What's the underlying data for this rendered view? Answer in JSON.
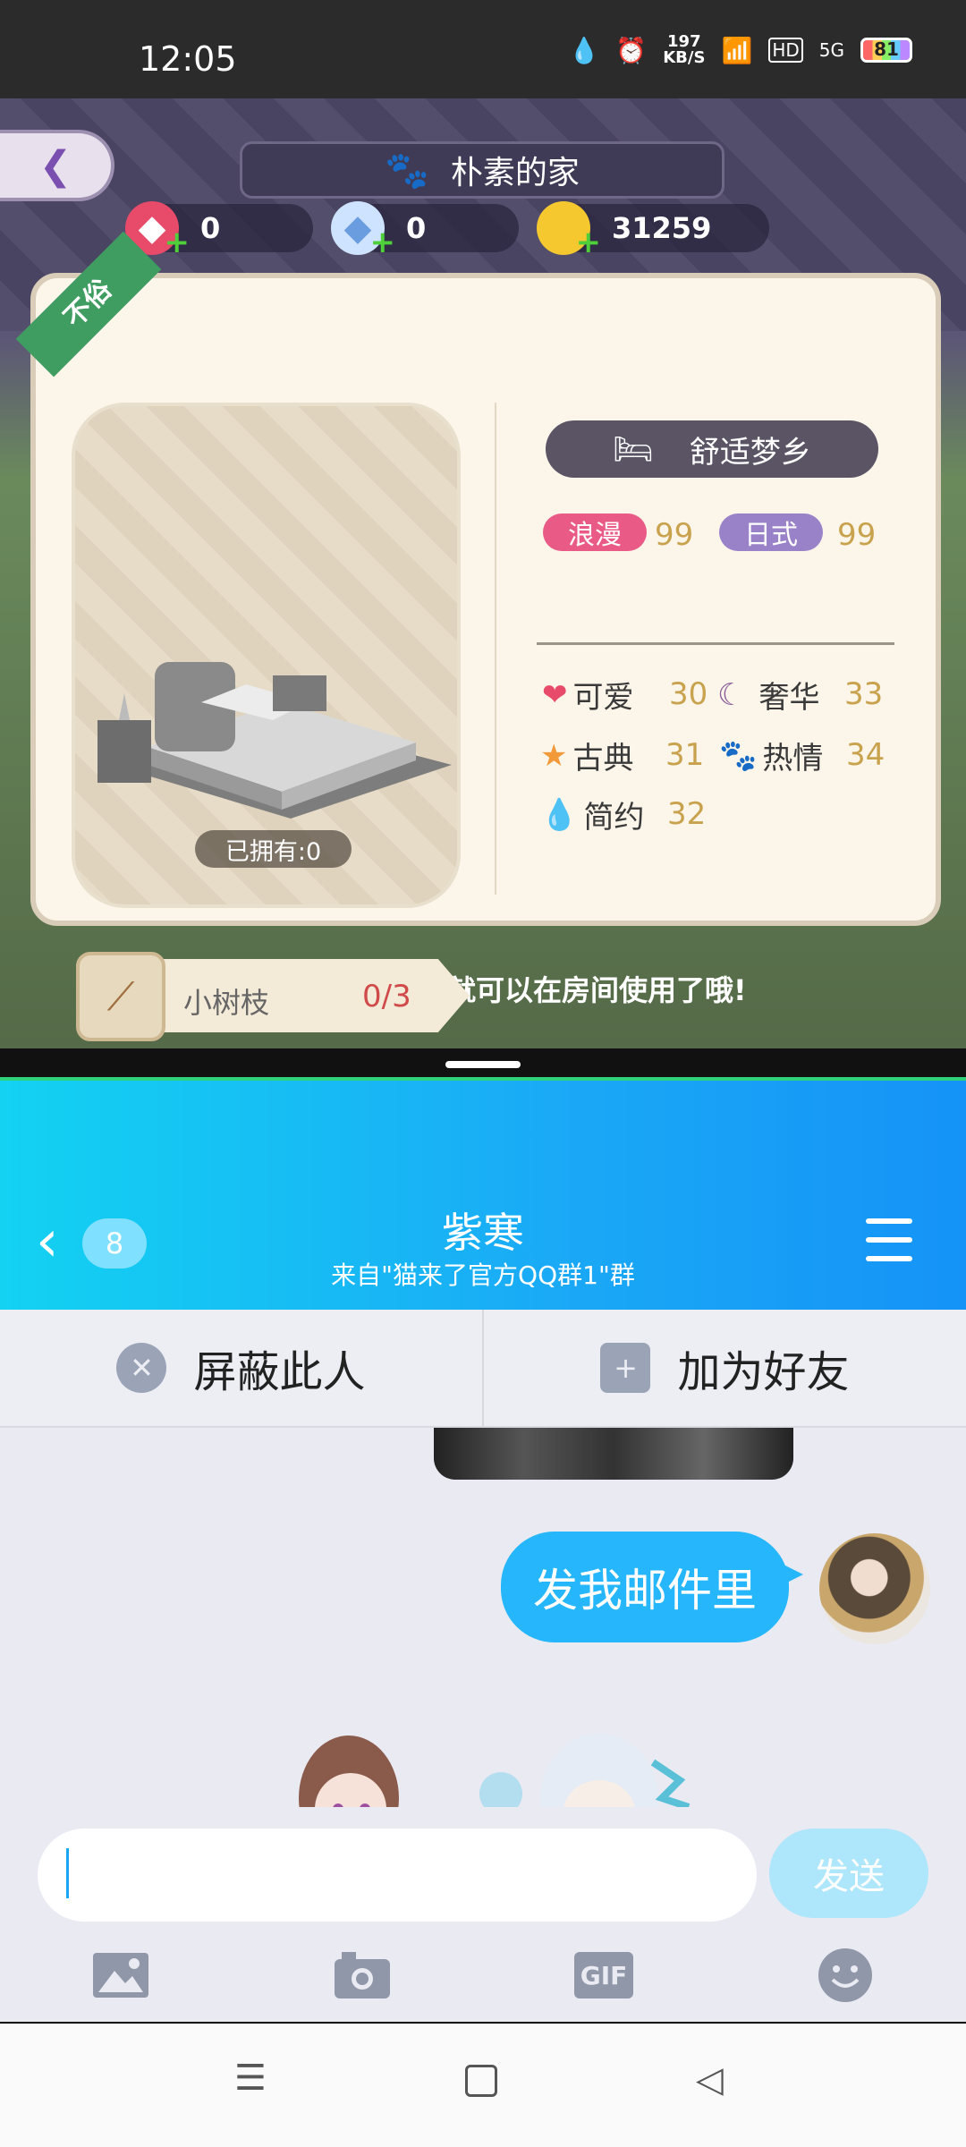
{
  "status_bar": {
    "time": "12:05",
    "speed_value": "197",
    "speed_unit": "KB/S",
    "hd": "HD",
    "network": "5G",
    "battery": "81"
  },
  "game": {
    "room_title": "朴素的家",
    "currency": {
      "ruby": "0",
      "diamond": "0",
      "gold": "31259"
    },
    "ribbon": "不俗",
    "owned_label": "已拥有:0",
    "set_name": "舒适梦乡",
    "tags": [
      {
        "label": "浪漫",
        "value": "99",
        "color": "#ea5a86"
      },
      {
        "label": "日式",
        "value": "99",
        "color": "#9a82c8"
      }
    ],
    "attributes": [
      {
        "label": "可爱",
        "value": "30",
        "icon": "heart-swirl-icon"
      },
      {
        "label": "奢华",
        "value": "33",
        "icon": "moon-icon"
      },
      {
        "label": "古典",
        "value": "31",
        "icon": "star-icon"
      },
      {
        "label": "热情",
        "value": "34",
        "icon": "paw-icon"
      },
      {
        "label": "简约",
        "value": "32",
        "icon": "droplet-icon"
      }
    ],
    "task": {
      "item_name": "小树枝",
      "progress": "0/3",
      "hint": "就可以在房间使用了哦!"
    }
  },
  "chat": {
    "unread_count": "8",
    "title": "紫寒",
    "subtitle": "来自\"猫来了官方QQ群1\"群",
    "actions": {
      "block": "屏蔽此人",
      "add_friend": "加为好友"
    },
    "message": "发我邮件里",
    "input_placeholder": "",
    "send_label": "发送",
    "toolbar": [
      "image-icon",
      "camera-icon",
      "gif-icon",
      "emoji-icon"
    ],
    "gif_label": "GIF"
  },
  "nav": [
    "menu-icon",
    "home-icon",
    "back-icon"
  ]
}
